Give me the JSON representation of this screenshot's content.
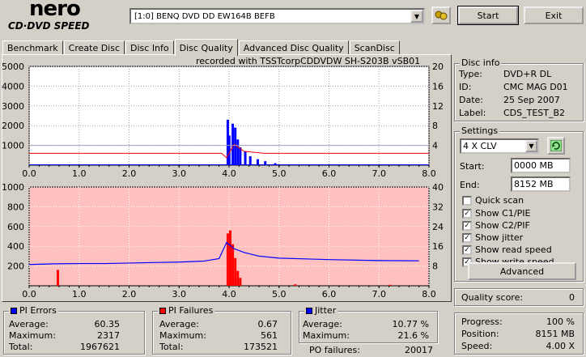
{
  "app": {
    "logo_top": "nero",
    "logo_sub": "CD·DVD SPEED"
  },
  "toolbar": {
    "drive": "[1:0]  BENQ DVD DD EW164B BEFB",
    "start_label": "Start",
    "exit_label": "Exit"
  },
  "tabs": [
    {
      "label": "Benchmark"
    },
    {
      "label": "Create Disc"
    },
    {
      "label": "Disc Info"
    },
    {
      "label": "Disc Quality",
      "active": true
    },
    {
      "label": "Advanced Disc Quality"
    },
    {
      "label": "ScanDisc"
    }
  ],
  "recorded_with": "recorded with TSSTcorpCDDVDW SH-S203B  vSB01",
  "disc_info": {
    "title": "Disc info",
    "type_label": "Type:",
    "type": "DVD+R DL",
    "id_label": "ID:",
    "id": "CMC MAG D01",
    "date_label": "Date:",
    "date": "25 Sep 2007",
    "label_label": "Label:",
    "label": "CDS_TEST_B2"
  },
  "settings": {
    "title": "Settings",
    "speed": "4 X CLV",
    "start_label": "Start:",
    "start": "0000 MB",
    "end_label": "End:",
    "end": "8152 MB",
    "quick_scan": "Quick scan",
    "show_c1": "Show C1/PIE",
    "show_c2": "Show C2/PIF",
    "show_jitter": "Show jitter",
    "show_read": "Show read speed",
    "show_write": "Show write speed",
    "checked": {
      "quick": false,
      "c1": true,
      "c2": true,
      "jitter": true,
      "read": true,
      "write": true
    },
    "advanced_label": "Advanced"
  },
  "quality": {
    "label": "Quality score:",
    "value": "0"
  },
  "progress": {
    "progress_label": "Progress:",
    "progress": "100 %",
    "position_label": "Position:",
    "position": "8151 MB",
    "speed_label": "Speed:",
    "speed": "4.00 X"
  },
  "pi_errors": {
    "title": "PI Errors",
    "average_label": "Average:",
    "average": "60.35",
    "maximum_label": "Maximum:",
    "maximum": "2317",
    "total_label": "Total:",
    "total": "1967621"
  },
  "pi_failures": {
    "title": "PI Failures",
    "average_label": "Average:",
    "average": "0.67",
    "maximum_label": "Maximum:",
    "maximum": "561",
    "total_label": "Total:",
    "total": "173521"
  },
  "jitter": {
    "title": "Jitter",
    "average_label": "Average:",
    "average": "10.77 %",
    "maximum_label": "Maximum:",
    "maximum": "21.6 %",
    "po_label": "PO failures:",
    "po": "20017"
  },
  "colors": {
    "pie": "#0000ff",
    "pif": "#ff0000",
    "speed_write": "#ff0000",
    "speed_read": "#0000cc",
    "jitter": "#0000ff",
    "upper_bg": "#ffffff",
    "lower_bg": "#ffc0c0"
  },
  "chart_data": [
    {
      "type": "line",
      "name": "pi-errors-chart",
      "x_ticks": [
        "0.0",
        "1.0",
        "2.0",
        "3.0",
        "4.0",
        "5.0",
        "6.0",
        "7.0",
        "8.0"
      ],
      "y_ticks_left": [
        "1000",
        "2000",
        "3000",
        "4000",
        "5000"
      ],
      "y_ticks_right": [
        "4",
        "8",
        "12",
        "16",
        "20"
      ],
      "xlim": [
        0,
        8
      ],
      "ylim_left": [
        0,
        5000
      ],
      "ylim_right": [
        0,
        20
      ],
      "pie_baseline": 40,
      "pie_spikes": [
        [
          3.95,
          2300
        ],
        [
          3.98,
          1500
        ],
        [
          4.05,
          2100
        ],
        [
          4.1,
          1900
        ],
        [
          4.15,
          1300
        ],
        [
          4.2,
          900
        ],
        [
          4.3,
          700
        ],
        [
          4.4,
          450
        ],
        [
          4.55,
          300
        ],
        [
          4.7,
          200
        ],
        [
          4.9,
          100
        ]
      ],
      "write_speed": [
        [
          0,
          2.4
        ],
        [
          3.85,
          2.4
        ],
        [
          3.95,
          1.5
        ],
        [
          4.1,
          4.2
        ],
        [
          4.3,
          2.8
        ],
        [
          4.7,
          2.4
        ],
        [
          8.0,
          2.4
        ]
      ],
      "read_speed": [
        [
          0,
          4.0
        ],
        [
          8.0,
          4.0
        ]
      ]
    },
    {
      "type": "bar",
      "name": "pi-failures-chart",
      "x_ticks": [
        "0.0",
        "1.0",
        "2.0",
        "3.0",
        "4.0",
        "5.0",
        "6.0",
        "7.0",
        "8.0"
      ],
      "y_ticks_left": [
        "200",
        "400",
        "600",
        "800",
        "1000"
      ],
      "y_ticks_right": [
        "8",
        "16",
        "24",
        "32",
        "40"
      ],
      "xlim": [
        0,
        8
      ],
      "ylim_left": [
        0,
        1000
      ],
      "ylim_right": [
        0,
        40
      ],
      "pif_spikes": [
        [
          0.55,
          160
        ],
        [
          3.95,
          530
        ],
        [
          4.0,
          560
        ],
        [
          4.05,
          420
        ],
        [
          4.1,
          280
        ],
        [
          4.15,
          150
        ],
        [
          4.2,
          80
        ],
        [
          5.3,
          15
        ],
        [
          7.2,
          10
        ]
      ],
      "jitter": [
        [
          0,
          8.6
        ],
        [
          0.5,
          8.9
        ],
        [
          1.0,
          9.0
        ],
        [
          1.5,
          9.0
        ],
        [
          2.0,
          9.2
        ],
        [
          2.5,
          9.4
        ],
        [
          3.0,
          9.6
        ],
        [
          3.5,
          10.0
        ],
        [
          3.8,
          11.0
        ],
        [
          3.95,
          17.5
        ],
        [
          4.1,
          15.0
        ],
        [
          4.3,
          13.5
        ],
        [
          4.6,
          12.0
        ],
        [
          5.0,
          11.2
        ],
        [
          6.0,
          10.6
        ],
        [
          7.0,
          10.2
        ],
        [
          7.8,
          10.1
        ]
      ]
    }
  ]
}
